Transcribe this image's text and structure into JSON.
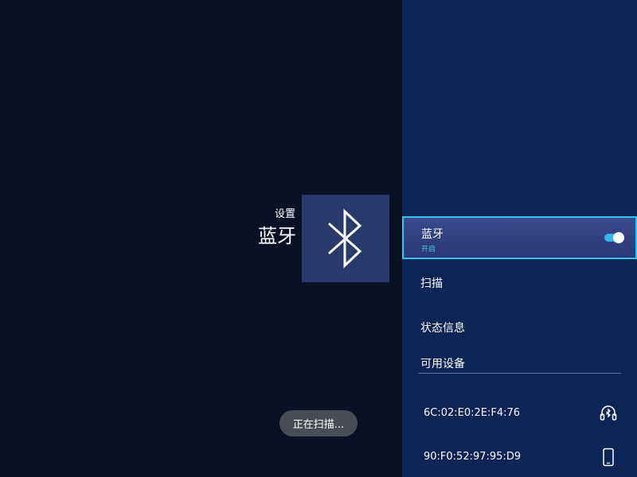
{
  "header": {
    "subtitle": "设置",
    "title": "蓝牙"
  },
  "tile": {
    "icon": "bluetooth-icon"
  },
  "toast": {
    "text": "正在扫描..."
  },
  "menu": {
    "bluetooth": {
      "label": "蓝牙",
      "status": "开启",
      "toggle_on": true,
      "accent": "#29c7f2"
    },
    "scan": {
      "label": "扫描"
    },
    "status_info": {
      "label": "状态信息"
    }
  },
  "available_devices": {
    "header": "可用设备",
    "items": [
      {
        "address": "6C:02:E0:2E:F4:76",
        "icon": "headphones-icon"
      },
      {
        "address": "90:F0:52:97:95:D9",
        "icon": "phone-icon"
      }
    ]
  },
  "colors": {
    "left_bg": "#0b1124",
    "right_bg": "#0d2457",
    "tile_bg": "#2a3a6a",
    "highlight": "#36cef0"
  }
}
